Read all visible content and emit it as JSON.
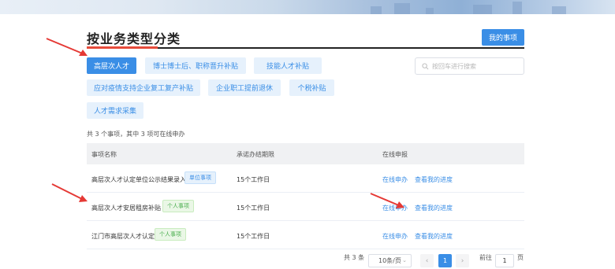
{
  "header": {
    "title": "按业务类型分类",
    "my_items_button": "我的事项"
  },
  "categories": [
    {
      "label": "高层次人才",
      "active": true
    },
    {
      "label": "博士博士后、职称晋升补贴",
      "active": false
    },
    {
      "label": "技能人才补贴",
      "active": false
    },
    {
      "label": "应对疫情支持企业复工复产补贴",
      "active": false
    },
    {
      "label": "企业职工提前退休",
      "active": false
    },
    {
      "label": "个税补贴",
      "active": false
    },
    {
      "label": "人才需求采集",
      "active": false
    }
  ],
  "search": {
    "placeholder": "按回车进行搜索"
  },
  "summary": "共 3 个事项，其中 3 项可在线申办",
  "table": {
    "headers": [
      "事项名称",
      "承诺办结期限",
      "在线申报"
    ],
    "rows": [
      {
        "name": "高层次人才认定单位公示结果录入",
        "badge": "单位事项",
        "badge_type": "unit",
        "deadline": "15个工作日",
        "apply": "在线申办",
        "progress": "查看我的进度"
      },
      {
        "name": "高层次人才安居租房补贴",
        "badge": "个人事项",
        "badge_type": "person",
        "deadline": "15个工作日",
        "apply": "在线申办",
        "progress": "查看我的进度"
      },
      {
        "name": "江门市高层次人才认定",
        "badge": "个人事项",
        "badge_type": "person",
        "deadline": "15个工作日",
        "apply": "在线申办",
        "progress": "查看我的进度"
      }
    ]
  },
  "pagination": {
    "total": "共 3 条",
    "page_size": "10条/页",
    "prev": "‹",
    "current": "1",
    "next": "›",
    "goto_label": "前往",
    "goto_value": "1",
    "page_suffix": "页"
  },
  "colors": {
    "accent": "#3a8ee6",
    "annotation_arrow": "#e53935"
  }
}
